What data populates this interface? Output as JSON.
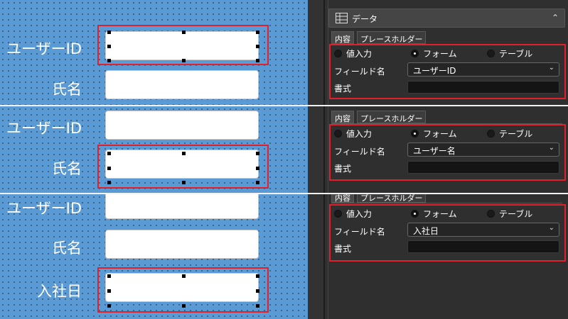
{
  "labels": {
    "user_id": "ユーザーID",
    "name": "氏名",
    "join_date": "入社日"
  },
  "property_panel": {
    "section_title": "データ",
    "tabs": [
      "内容",
      "プレースホルダー"
    ],
    "value_input": "値入力",
    "form": "フォーム",
    "table": "テーブル",
    "field_name_label": "フィールド名",
    "format_label": "書式",
    "selected_mode": "フォーム"
  },
  "panels": [
    {
      "field_name_value": "ユーザーID"
    },
    {
      "field_name_value": "ユーザー名"
    },
    {
      "field_name_value": "入社日"
    }
  ],
  "colors": {
    "canvas_blue": "#5b9bd5",
    "selection_red": "#e0202a",
    "panel_dark": "#2f2f2f"
  },
  "icons": [
    "grid-table-icon",
    "chevron-up-icon",
    "chevron-down-icon"
  ]
}
